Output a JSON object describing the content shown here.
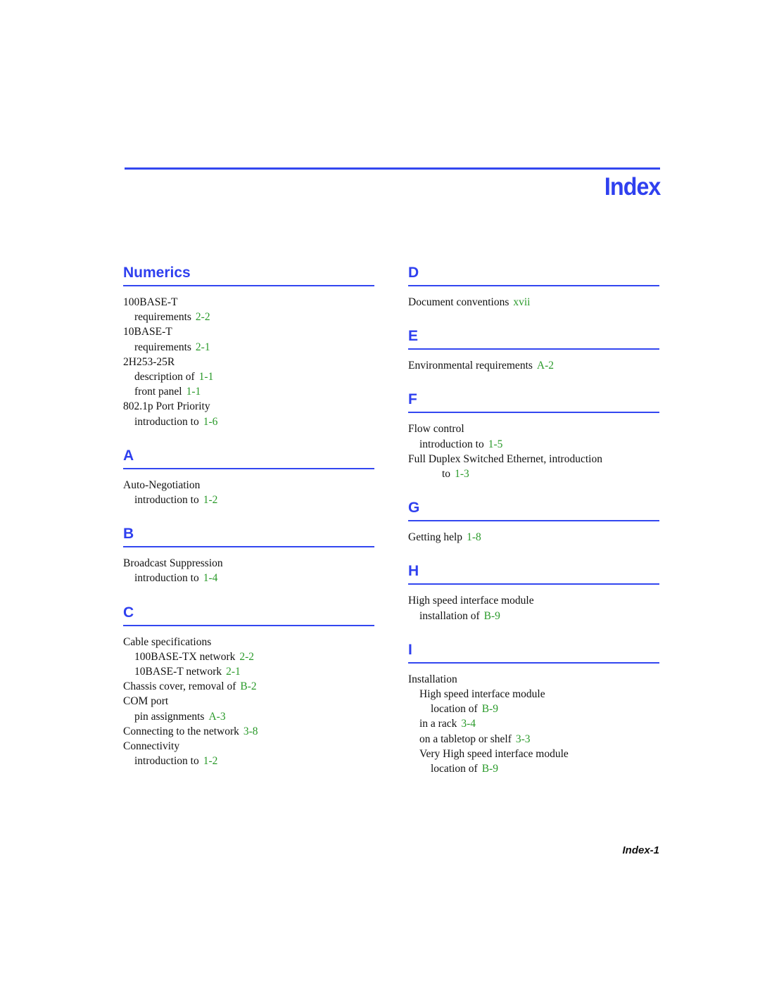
{
  "title": "Index",
  "footer": "Index-1",
  "colors": {
    "heading": "#2f40ef",
    "rule": "#3347f0",
    "page_ref": "#2a9a2a",
    "text": "#111111"
  },
  "sections": {
    "numerics": {
      "heading": "Numerics",
      "entries": [
        {
          "text": "100BASE-T",
          "ref": ""
        },
        {
          "text": "requirements",
          "ref": "2-2"
        },
        {
          "text": "10BASE-T",
          "ref": ""
        },
        {
          "text": "requirements",
          "ref": "2-1"
        },
        {
          "text": "2H253-25R",
          "ref": ""
        },
        {
          "text": "description of",
          "ref": "1-1"
        },
        {
          "text": "front panel",
          "ref": "1-1"
        },
        {
          "text": "802.1p Port Priority",
          "ref": ""
        },
        {
          "text": "introduction to",
          "ref": "1-6"
        }
      ]
    },
    "a": {
      "heading": "A",
      "entries": [
        {
          "text": "Auto-Negotiation",
          "ref": ""
        },
        {
          "text": "introduction to",
          "ref": "1-2"
        }
      ]
    },
    "b": {
      "heading": "B",
      "entries": [
        {
          "text": "Broadcast Suppression",
          "ref": ""
        },
        {
          "text": "introduction to",
          "ref": "1-4"
        }
      ]
    },
    "c": {
      "heading": "C",
      "entries": [
        {
          "text": "Cable specifications",
          "ref": ""
        },
        {
          "text": "100BASE-TX network",
          "ref": "2-2"
        },
        {
          "text": "10BASE-T network",
          "ref": "2-1"
        },
        {
          "text": "Chassis cover, removal of",
          "ref": "B-2"
        },
        {
          "text": "COM port",
          "ref": ""
        },
        {
          "text": "pin assignments",
          "ref": "A-3"
        },
        {
          "text": "Connecting to the network",
          "ref": "3-8"
        },
        {
          "text": "Connectivity",
          "ref": ""
        },
        {
          "text": "introduction to",
          "ref": "1-2"
        }
      ]
    },
    "d": {
      "heading": "D",
      "entries": [
        {
          "text": "Document conventions",
          "ref": "xvii"
        }
      ]
    },
    "e": {
      "heading": "E",
      "entries": [
        {
          "text": "Environmental requirements",
          "ref": "A-2"
        }
      ]
    },
    "f": {
      "heading": "F",
      "entries": [
        {
          "text": "Flow control",
          "ref": ""
        },
        {
          "text": "introduction to",
          "ref": "1-5"
        },
        {
          "text": "Full Duplex Switched Ethernet, introduction",
          "ref": ""
        },
        {
          "text": "to",
          "ref": "1-3"
        }
      ]
    },
    "g": {
      "heading": "G",
      "entries": [
        {
          "text": "Getting help",
          "ref": "1-8"
        }
      ]
    },
    "h": {
      "heading": "H",
      "entries": [
        {
          "text": "High speed interface module",
          "ref": ""
        },
        {
          "text": "installation of",
          "ref": "B-9"
        }
      ]
    },
    "i": {
      "heading": "I",
      "entries": [
        {
          "text": "Installation",
          "ref": ""
        },
        {
          "text": "High speed interface module",
          "ref": ""
        },
        {
          "text": "location of",
          "ref": "B-9"
        },
        {
          "text": "in a rack",
          "ref": "3-4"
        },
        {
          "text": "on a tabletop or shelf",
          "ref": "3-3"
        },
        {
          "text": "Very High speed interface module",
          "ref": ""
        },
        {
          "text": "location of",
          "ref": "B-9"
        }
      ]
    }
  }
}
